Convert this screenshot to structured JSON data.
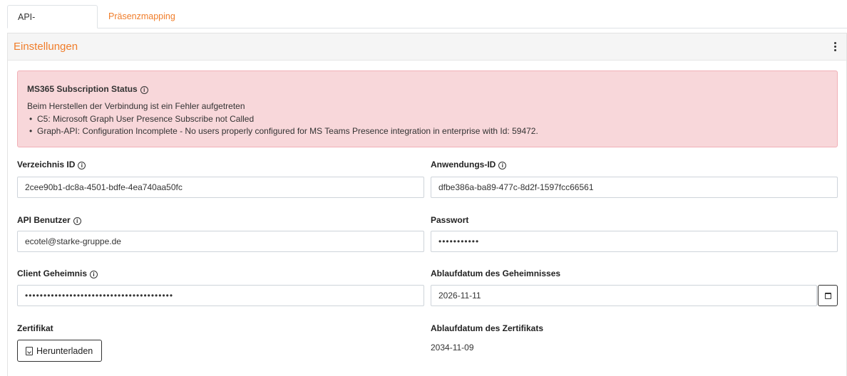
{
  "tabs": [
    {
      "label": "API-Einstellungen",
      "active": true
    },
    {
      "label": "Präsenzmapping",
      "active": false
    }
  ],
  "card": {
    "title": "Einstellungen",
    "menu_icon": "kebab-menu-icon"
  },
  "alert": {
    "title": "MS365 Subscription Status",
    "message": "Beim Herstellen der Verbindung ist ein Fehler aufgetreten",
    "items": [
      "C5: Microsoft Graph User Presence Subscribe not Called",
      "Graph-API: Configuration Incomplete - No users properly configured for MS Teams Presence integration in enterprise with Id: 59472."
    ]
  },
  "fields": {
    "directory_id": {
      "label": "Verzeichnis ID",
      "value": "2cee90b1-dc8a-4501-bdfe-4ea740aa50fc"
    },
    "application_id": {
      "label": "Anwendungs-ID",
      "value": "dfbe386a-ba89-477c-8d2f-1597fcc66561"
    },
    "api_user": {
      "label": "API Benutzer",
      "value": "ecotel@starke-gruppe.de"
    },
    "password": {
      "label": "Passwort",
      "value": "•••••••••••"
    },
    "client_secret": {
      "label": "Client Geheimnis",
      "value": "••••••••••••••••••••••••••••••••••••••••"
    },
    "secret_expiry": {
      "label": "Ablaufdatum des Geheimnisses",
      "value": "2026-11-11"
    },
    "certificate": {
      "label": "Zertifikat",
      "download_label": "Herunterladen"
    },
    "certificate_expiry": {
      "label": "Ablaufdatum des Zertifikats",
      "value": "2034-11-09"
    }
  },
  "icons": {
    "info": "info-icon",
    "calendar": "calendar-icon",
    "download": "file-download-icon"
  },
  "colors": {
    "accent": "#f07d2a",
    "alert_bg": "#f8d7da",
    "alert_border": "#f1b0b7"
  }
}
